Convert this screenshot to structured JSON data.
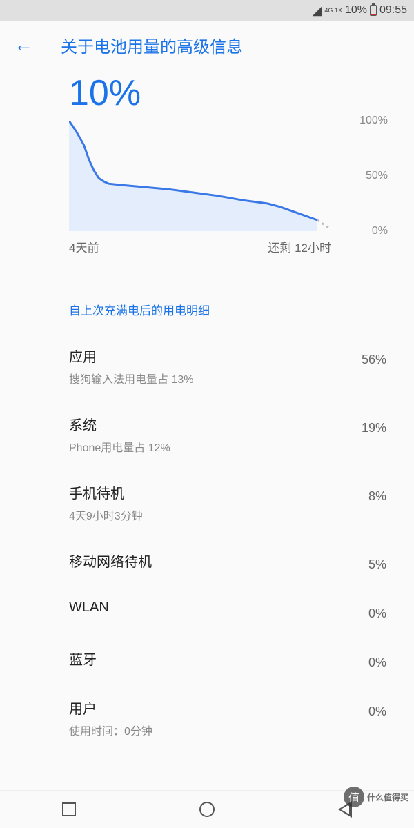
{
  "status": {
    "network": "4G\n1X",
    "battery_pct": "10%",
    "time": "09:55"
  },
  "header": {
    "title": "关于电池用量的高级信息"
  },
  "battery": {
    "current_pct": "10%"
  },
  "chart_data": {
    "type": "line",
    "title": "",
    "xlabel": "",
    "ylabel": "",
    "ylim": [
      0,
      100
    ],
    "y_ticks": [
      "100%",
      "50%",
      "0%"
    ],
    "x_start_label": "4天前",
    "x_end_label": "还剩 12小时",
    "x": [
      0,
      3,
      6,
      8,
      10,
      12,
      14,
      16,
      20,
      30,
      40,
      50,
      60,
      70,
      80,
      85,
      90,
      95,
      100
    ],
    "values": [
      100,
      90,
      78,
      65,
      55,
      48,
      45,
      43,
      42,
      40,
      38,
      35,
      32,
      28,
      25,
      22,
      18,
      14,
      10
    ]
  },
  "section": {
    "header": "自上次充满电后的用电明细"
  },
  "items": [
    {
      "title": "应用",
      "sub": "搜狗输入法用电量占 13%",
      "pct": "56%"
    },
    {
      "title": "系统",
      "sub": "Phone用电量占 12%",
      "pct": "19%"
    },
    {
      "title": "手机待机",
      "sub": "4天9小时3分钟",
      "pct": "8%"
    },
    {
      "title": "移动网络待机",
      "sub": "",
      "pct": "5%"
    },
    {
      "title": "WLAN",
      "sub": "",
      "pct": "0%"
    },
    {
      "title": "蓝牙",
      "sub": "",
      "pct": "0%"
    },
    {
      "title": "用户",
      "sub": "使用时间：0分钟",
      "pct": "0%"
    }
  ],
  "watermark": {
    "icon": "值",
    "text": "什么值得买"
  }
}
